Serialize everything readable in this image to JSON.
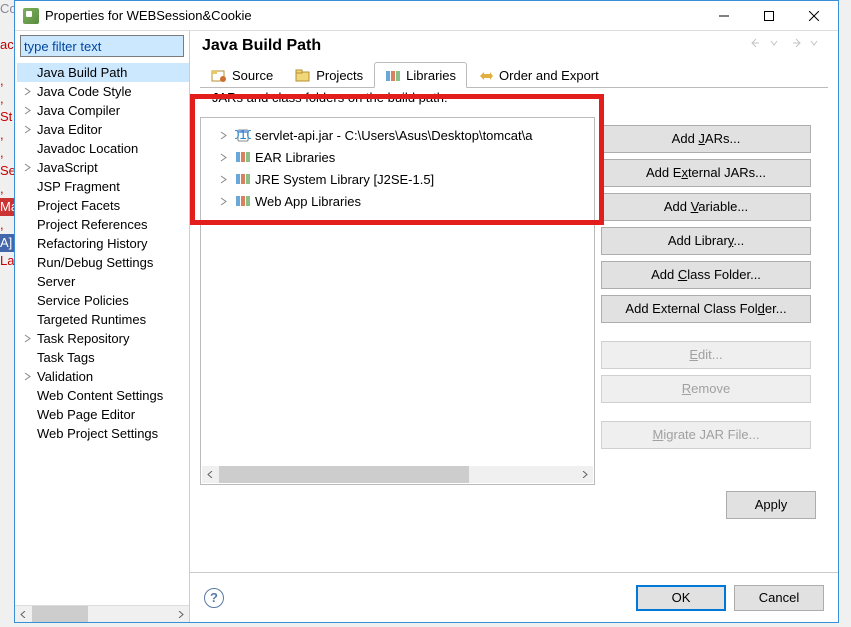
{
  "titlebar": {
    "text": "Properties for WEBSession&Cookie"
  },
  "filter": {
    "value": "type filter text"
  },
  "sidebarItems": [
    {
      "label": "Java Build Path",
      "expandable": false,
      "selected": true
    },
    {
      "label": "Java Code Style",
      "expandable": true
    },
    {
      "label": "Java Compiler",
      "expandable": true
    },
    {
      "label": "Java Editor",
      "expandable": true
    },
    {
      "label": "Javadoc Location",
      "expandable": false
    },
    {
      "label": "JavaScript",
      "expandable": true
    },
    {
      "label": "JSP Fragment",
      "expandable": false
    },
    {
      "label": "Project Facets",
      "expandable": false
    },
    {
      "label": "Project References",
      "expandable": false
    },
    {
      "label": "Refactoring History",
      "expandable": false
    },
    {
      "label": "Run/Debug Settings",
      "expandable": false
    },
    {
      "label": "Server",
      "expandable": false
    },
    {
      "label": "Service Policies",
      "expandable": false
    },
    {
      "label": "Targeted Runtimes",
      "expandable": false
    },
    {
      "label": "Task Repository",
      "expandable": true
    },
    {
      "label": "Task Tags",
      "expandable": false
    },
    {
      "label": "Validation",
      "expandable": true
    },
    {
      "label": "Web Content Settings",
      "expandable": false
    },
    {
      "label": "Web Page Editor",
      "expandable": false
    },
    {
      "label": "Web Project Settings",
      "expandable": false
    }
  ],
  "header": {
    "title": "Java Build Path"
  },
  "tabs": [
    {
      "label": "Source",
      "icon": "source"
    },
    {
      "label": "Projects",
      "icon": "projects"
    },
    {
      "label": "Libraries",
      "icon": "libraries",
      "active": true
    },
    {
      "label": "Order and Export",
      "icon": "order"
    }
  ],
  "jarDesc": "JARs and class folders on the build path:",
  "libItems": [
    {
      "label": "servlet-api.jar - C:\\Users\\Asus\\Desktop\\tomcat\\a",
      "icon": "jar"
    },
    {
      "label": "EAR Libraries",
      "icon": "lib"
    },
    {
      "label": "JRE System Library [J2SE-1.5]",
      "icon": "lib"
    },
    {
      "label": "Web App Libraries",
      "icon": "lib"
    }
  ],
  "buttons": {
    "addJars": "Add JARs...",
    "addExt": "Add External JARs...",
    "addVar": "Add Variable...",
    "addLib": "Add Library...",
    "addCls": "Add Class Folder...",
    "addExtCls": "Add External Class Folder...",
    "edit": "Edit...",
    "remove": "Remove",
    "migrate": "Migrate JAR File...",
    "apply": "Apply",
    "ok": "OK",
    "cancel": "Cancel"
  }
}
